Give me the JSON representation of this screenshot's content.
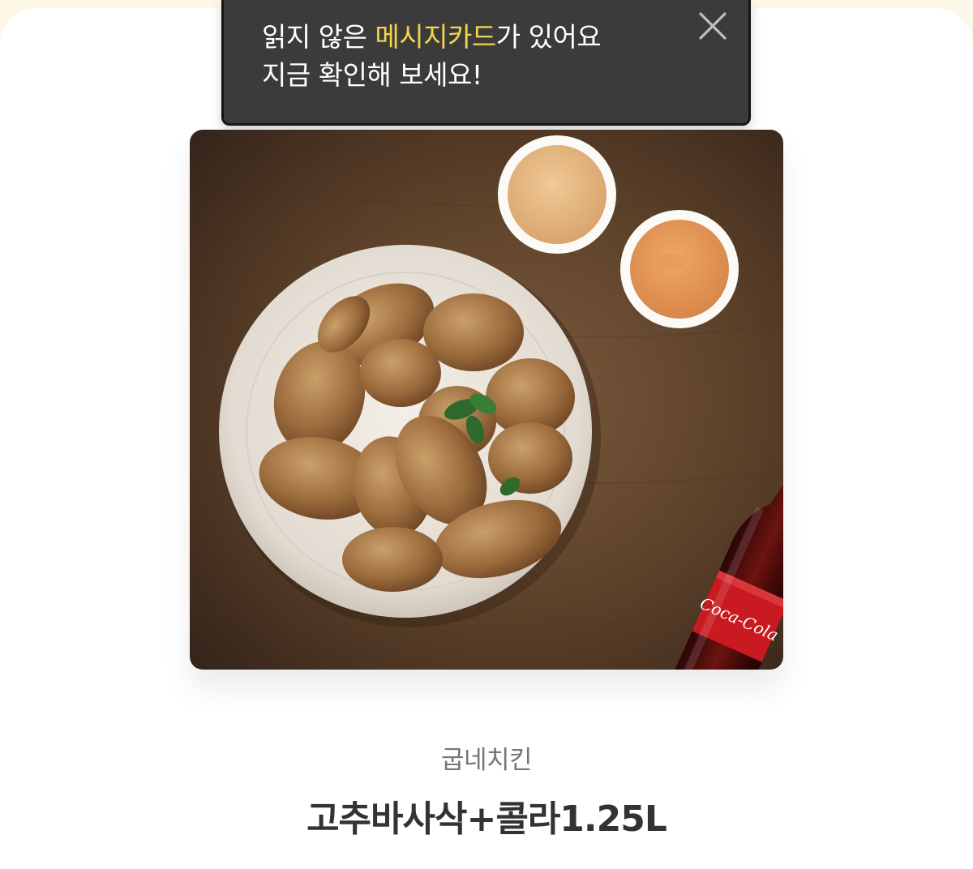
{
  "tooltip": {
    "line1_before": "읽지 않은 ",
    "line1_highlight": "메시지카드",
    "line1_after": "가 있어요",
    "line2": "지금 확인해 보세요!",
    "highlight_color": "#f6d54a",
    "close_icon": "close-icon"
  },
  "product": {
    "brand": "굽네치킨",
    "name": "고추바사삭+콜라1.25L",
    "image_label": "Coca-Cola"
  },
  "colors": {
    "background": "#fcf7e6",
    "sheet": "#ffffff",
    "tooltip_bg": "#3b3b3b",
    "brand_text": "#767676",
    "name_text": "#333333"
  }
}
